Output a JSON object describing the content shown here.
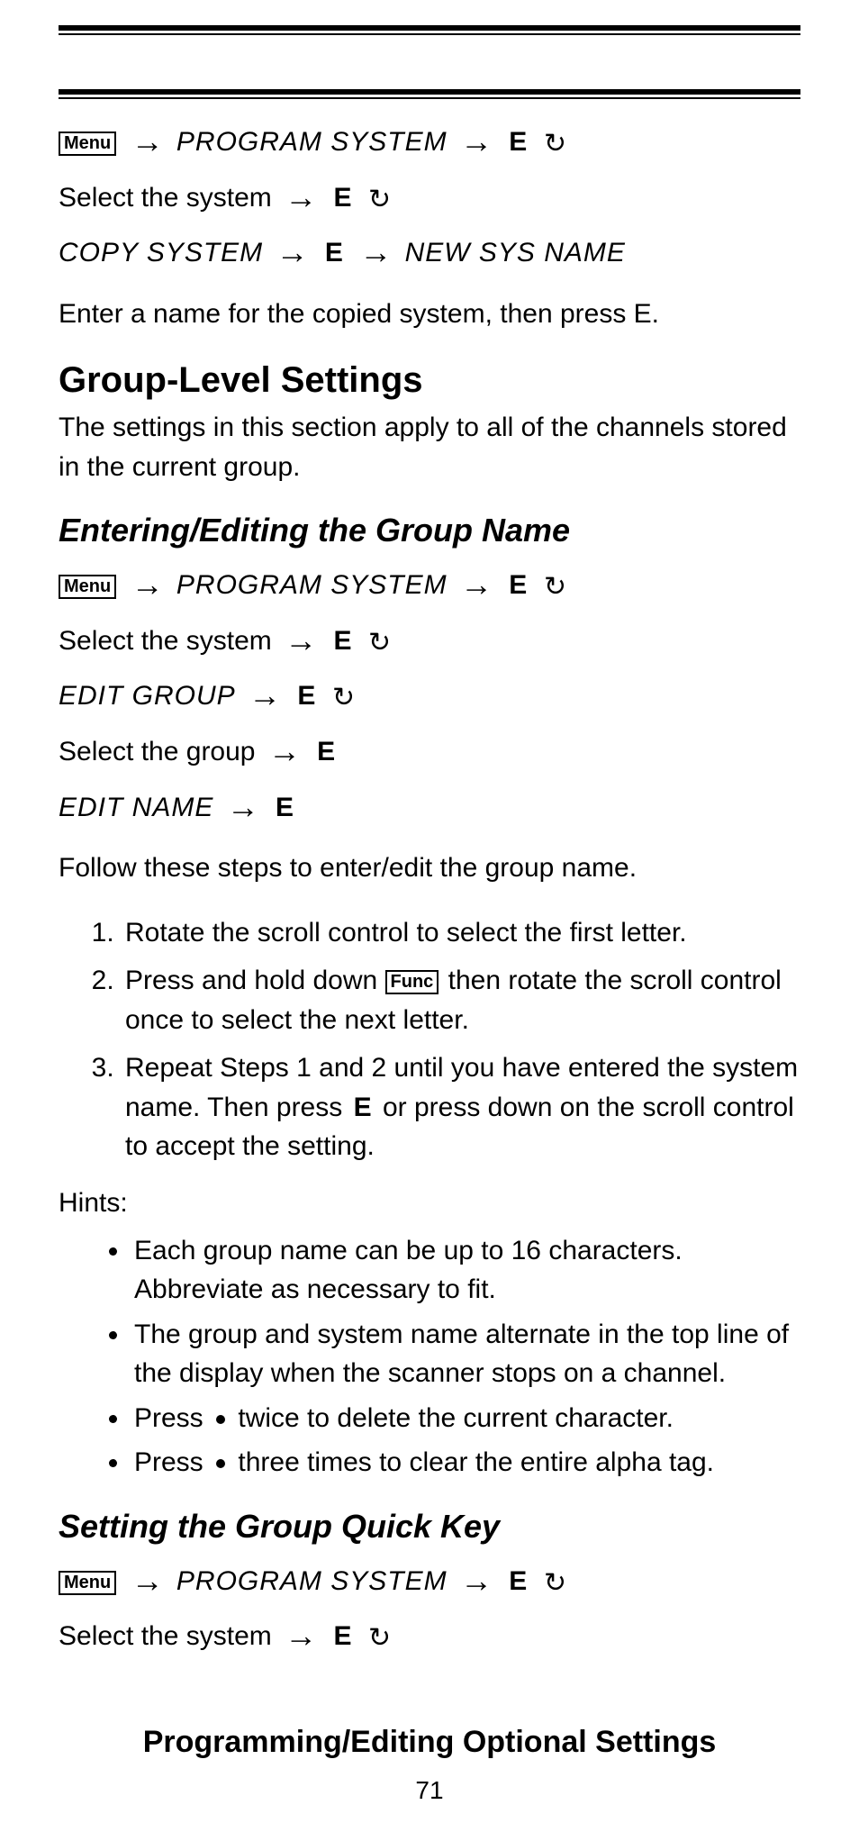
{
  "keys": {
    "menu": "Menu",
    "func": "Func",
    "e": "E"
  },
  "lcd": {
    "program_system": "PROGRAM SYSTEM",
    "copy_system": "COPY SYSTEM",
    "new_sys_name": "NEW SYS NAME",
    "edit_group": "EDIT GROUP",
    "edit_name": "EDIT NAME"
  },
  "text": {
    "select_the_system": "Select the system",
    "select_the_group": "Select the group",
    "enter_name": "Enter a name for the copied system, then press E.",
    "follow_steps": "Follow these steps to enter/edit the group name.",
    "hints_label": "Hints:",
    "press": "Press",
    "twice_delete": "twice to delete the current character.",
    "three_clear": "three times to clear the entire alpha tag."
  },
  "headings": {
    "group_level": "Group-Level Settings",
    "group_level_desc": "The settings in this section apply to all of the channels stored in the current group.",
    "enter_edit_group": "Entering/Editing the Group Name",
    "setting_quick_key": "Setting the Group Quick Key"
  },
  "steps": {
    "s1": "Rotate the scroll control to select the first letter.",
    "s2a": "Press and hold down",
    "s2b": "then rotate the scroll control once to select the next letter.",
    "s3a": "Repeat Steps 1 and 2 until you have entered the system name. Then press",
    "s3b": "or press down on the scroll control to accept the setting."
  },
  "hints": {
    "h1": "Each group name can be up to 16 characters. Abbreviate as necessary to fit.",
    "h2": "The group and system name alternate in the top line of the display when the scanner stops on a channel."
  },
  "footer": {
    "title": "Programming/Editing Optional Settings",
    "page": "71"
  }
}
